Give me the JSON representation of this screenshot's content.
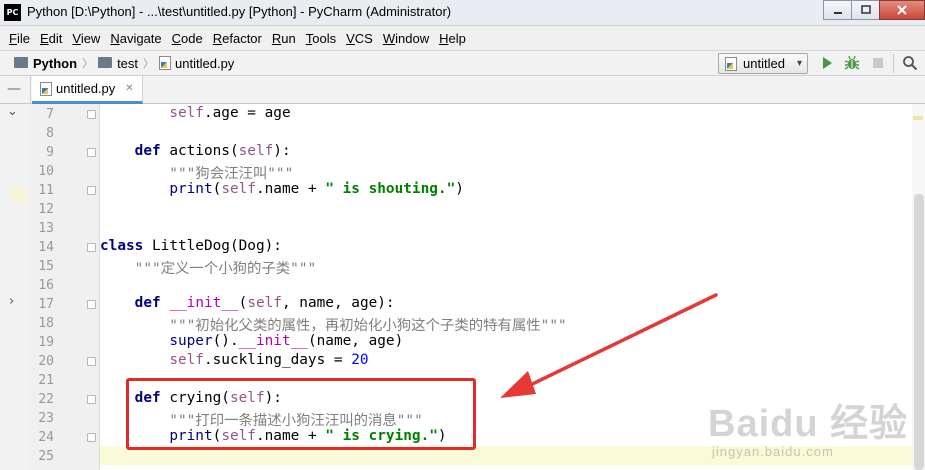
{
  "window": {
    "logo_text": "PC",
    "title": "Python [D:\\Python] - ...\\test\\untitled.py [Python] - PyCharm (Administrator)"
  },
  "menu": [
    "File",
    "Edit",
    "View",
    "Navigate",
    "Code",
    "Refactor",
    "Run",
    "Tools",
    "VCS",
    "Window",
    "Help"
  ],
  "breadcrumb": {
    "project": "Python",
    "folder": "test",
    "file": "untitled.py"
  },
  "run_config": {
    "label": "untitled"
  },
  "tab": {
    "label": "untitled.py"
  },
  "editor": {
    "line_numbers": [
      "7",
      "8",
      "9",
      "10",
      "11",
      "12",
      "13",
      "14",
      "15",
      "16",
      "17",
      "18",
      "19",
      "20",
      "21",
      "22",
      "23",
      "24",
      "25"
    ],
    "current_line": "25"
  },
  "watermark": {
    "brand": "Baidu 经验",
    "url": "jingyan.baidu.com"
  },
  "colors": {
    "keyword": "#000080",
    "self": "#94558d",
    "string": "#008000",
    "docstring": "#808080",
    "number": "#0000ff",
    "highlight_box": "#e02b2b",
    "arrow": "#e53935",
    "current_line": "#fbfad7"
  }
}
